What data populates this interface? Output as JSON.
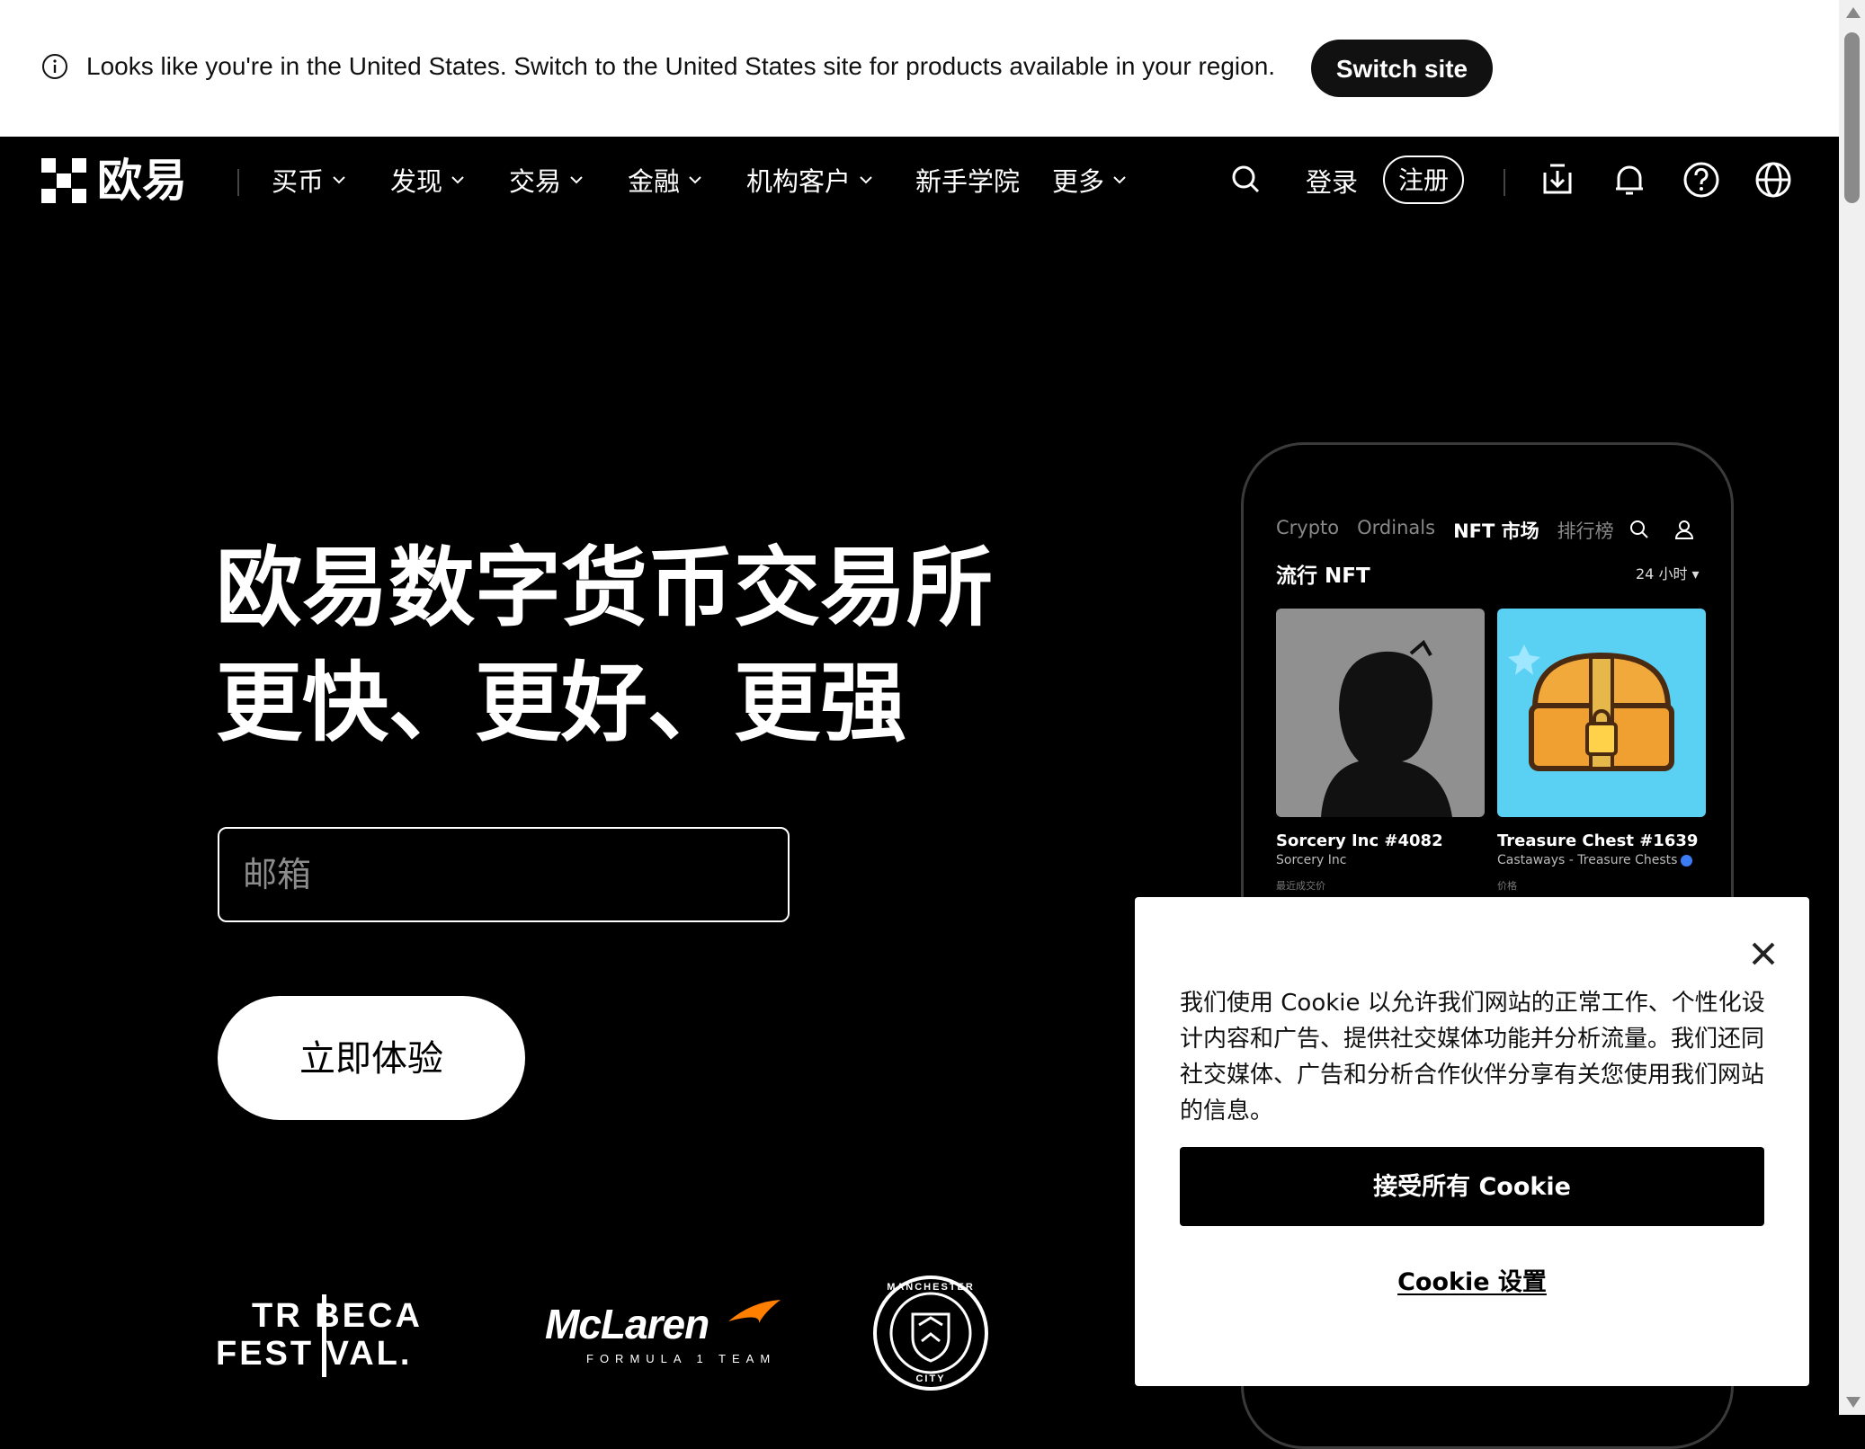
{
  "geo_banner": {
    "message": "Looks like you're in the United States. Switch to the United States site for products available in your region.",
    "switch_button": "Switch site"
  },
  "nav": {
    "logo_text": "欧易",
    "items": [
      {
        "label": "买币",
        "has_dropdown": true
      },
      {
        "label": "发现",
        "has_dropdown": true
      },
      {
        "label": "交易",
        "has_dropdown": true
      },
      {
        "label": "金融",
        "has_dropdown": true
      },
      {
        "label": "机构客户",
        "has_dropdown": true
      },
      {
        "label": "新手学院",
        "has_dropdown": false
      },
      {
        "label": "更多",
        "has_dropdown": true
      }
    ],
    "login": "登录",
    "register": "注册",
    "icons": [
      "search-icon",
      "download-icon",
      "bell-icon",
      "help-icon",
      "globe-icon"
    ]
  },
  "hero": {
    "title_line1": "欧易数字货币交易所",
    "title_line2": "更快、更好、更强",
    "email_placeholder": "邮箱",
    "cta": "立即体验"
  },
  "partners": {
    "tribeca_top": "TR BECA",
    "tribeca_bottom": "FEST VAL.",
    "mclaren_name": "McLaren",
    "mclaren_sub": "FORMULA 1 TEAM",
    "mancity_top": "MANCHESTER",
    "mancity_bottom": "CITY"
  },
  "phone": {
    "tabs": [
      "Crypto",
      "Ordinals",
      "NFT 市场",
      "排行榜"
    ],
    "active_tab": "NFT 市场",
    "section_title": "流行 NFT",
    "range": "24 小时 ▾",
    "nfts": [
      {
        "name": "Sorcery Inc #4082",
        "collection": "Sorcery Inc",
        "label": "最近成交价"
      },
      {
        "name": "Treasure Chest #1639",
        "collection": "Castaways - Treasure Chests",
        "label": "价格"
      }
    ]
  },
  "cookie": {
    "text": "我们使用 Cookie 以允许我们网站的正常工作、个性化设计内容和广告、提供社交媒体功能并分析流量。我们还同社交媒体、广告和分析合作伙伴分享有关您使用我们网站的信息。",
    "accept": "接受所有 Cookie",
    "settings": "Cookie 设置"
  },
  "colors": {
    "background": "#000000",
    "banner_bg": "#ffffff",
    "accent": "#111111"
  }
}
